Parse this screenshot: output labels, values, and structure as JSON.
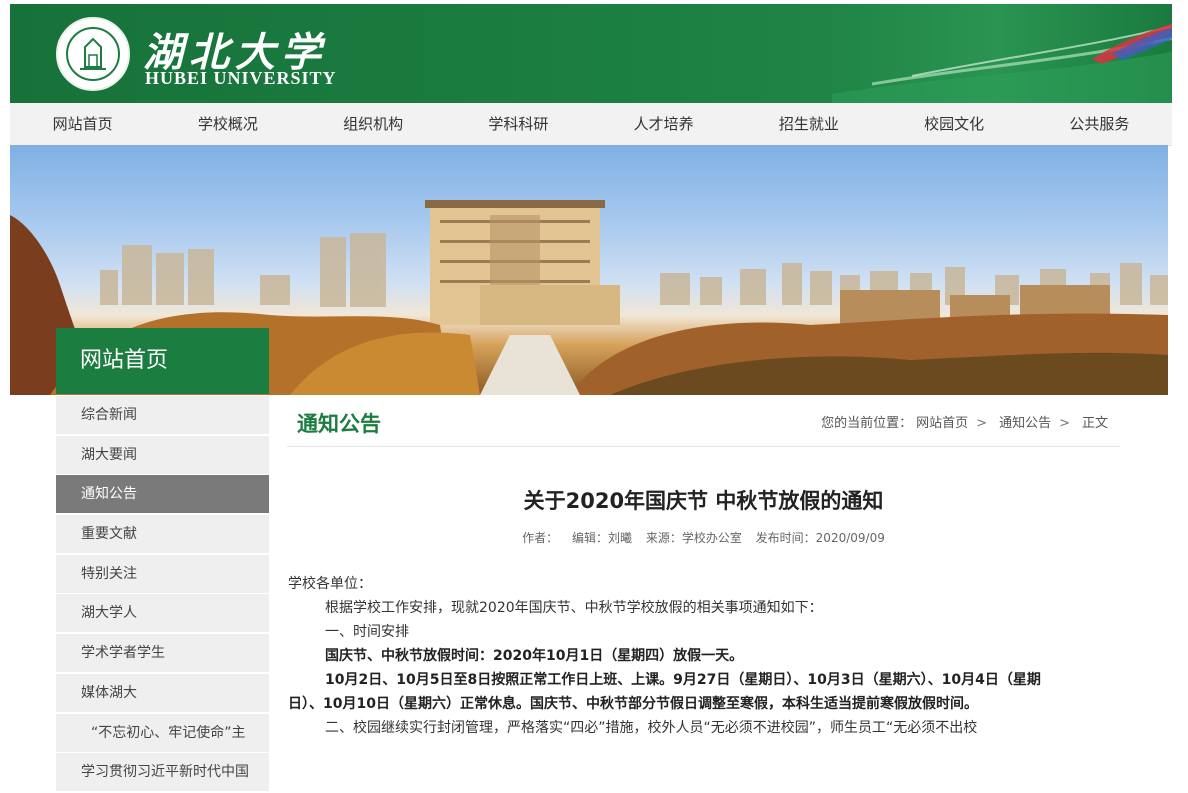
{
  "header": {
    "logo_cn": "湖北大学",
    "logo_en": "HUBEI UNIVERSITY",
    "brand_color": "#1b7d40"
  },
  "nav": [
    "网站首页",
    "学校概况",
    "组织机构",
    "学科科研",
    "人才培养",
    "招生就业",
    "校园文化",
    "公共服务"
  ],
  "sidebar": {
    "title": "网站首页",
    "items": [
      {
        "label": "综合新闻",
        "active": false
      },
      {
        "label": "湖大要闻",
        "active": false
      },
      {
        "label": "通知公告",
        "active": true
      },
      {
        "label": "重要文献",
        "active": false
      },
      {
        "label": "特别关注",
        "active": false
      },
      {
        "label": "湖大学人",
        "active": false
      },
      {
        "label": "学术学者学生",
        "active": false
      },
      {
        "label": "媒体湖大",
        "active": false
      },
      {
        "label": "“不忘初心、牢记使命”主",
        "active": false
      },
      {
        "label": "学习贯彻习近平新时代中国",
        "active": false
      }
    ]
  },
  "content": {
    "section_title": "通知公告",
    "breadcrumb_prefix": "您的当前位置：",
    "breadcrumb": [
      "网站首页",
      "通知公告",
      "正文"
    ],
    "breadcrumb_sep": ">",
    "article_title": "关于2020年国庆节 中秋节放假的通知",
    "meta": {
      "author": "作者：",
      "editor": "编辑：刘曦",
      "source": "来源：学校办公室",
      "date": "发布时间：2020/09/09"
    },
    "paragraphs": [
      {
        "text": "学校各单位：",
        "bold": false,
        "indent": 0
      },
      {
        "text": "根据学校工作安排，现就2020年国庆节、中秋节学校放假的相关事项通知如下：",
        "bold": false,
        "indent": 1
      },
      {
        "text": "一、时间安排",
        "bold": false,
        "indent": 1
      },
      {
        "text": "国庆节、中秋节放假时间：2020年10月1日（星期四）放假一天。",
        "bold": true,
        "indent": 1
      },
      {
        "text": "10月2日、10月5日至8日按照正常工作日上班、上课。9月27日（星期日）、10月3日（星期六）、10月4日（星期",
        "bold": true,
        "indent": 1
      },
      {
        "text": "日）、10月10日（星期六）正常休息。国庆节、中秋节部分节假日调整至寒假，本科生适当提前寒假放假时间。",
        "bold": true,
        "indent": 0
      },
      {
        "text": "二、校园继续实行封闭管理，严格落实“四必”措施，校外人员“无必须不进校园”，师生员工“无必须不出校",
        "bold": false,
        "indent": 1
      }
    ]
  }
}
